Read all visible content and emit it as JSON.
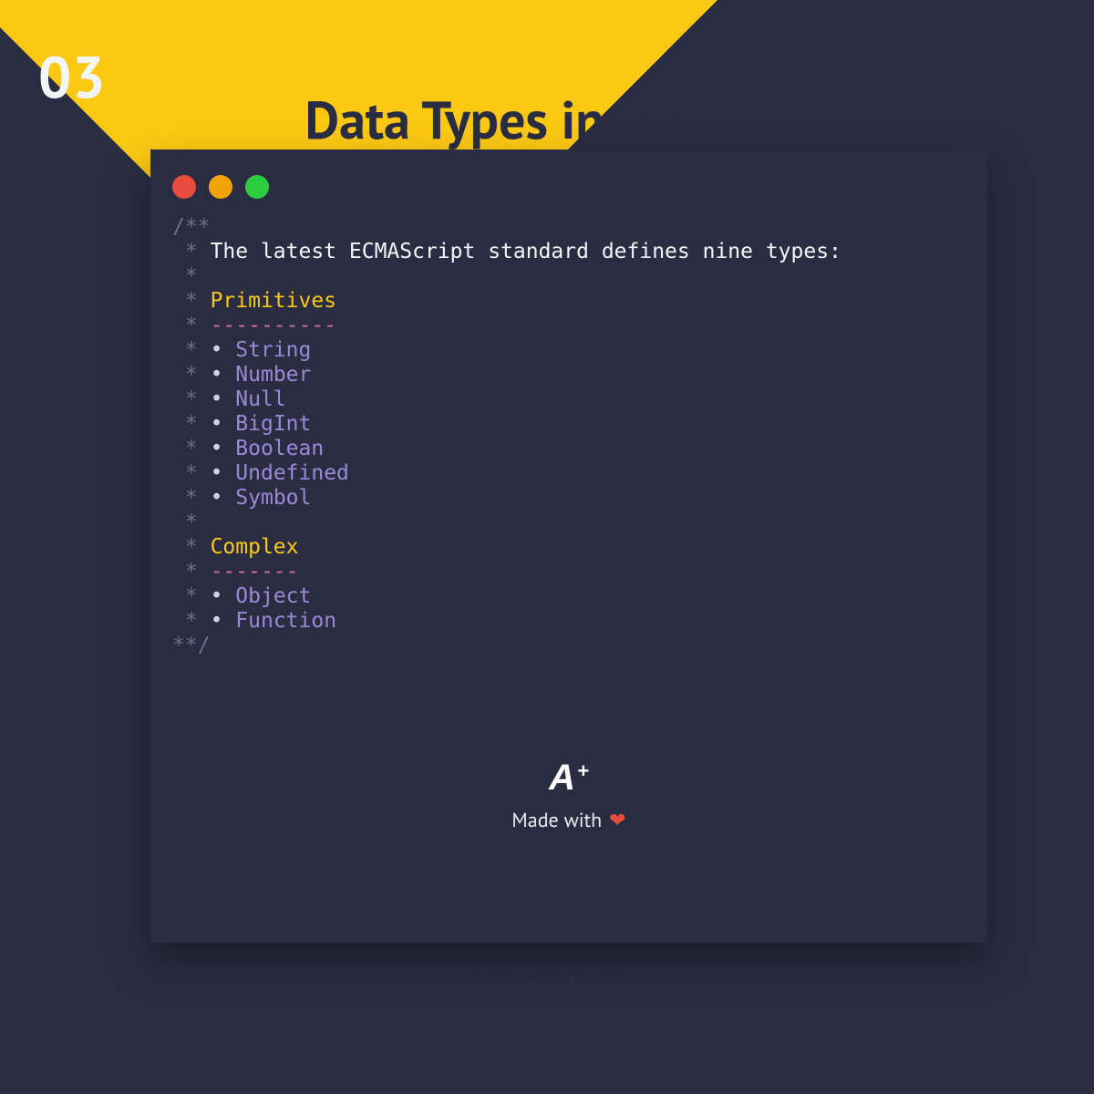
{
  "page_number": "03",
  "title": "Data Types in JavaScript",
  "code": {
    "open": "/**",
    "intro": "The latest ECMAScript standard defines nine types:",
    "section1": {
      "heading": "Primitives",
      "underline": "----------",
      "items": [
        "String",
        "Number",
        "Null",
        "BigInt",
        "Boolean",
        "Undefined",
        "Symbol"
      ]
    },
    "section2": {
      "heading": "Complex",
      "underline": "-------",
      "items": [
        "Object",
        "Function"
      ]
    },
    "close": "**/"
  },
  "footer": {
    "logo_text": "A",
    "logo_plus": "+",
    "made_with": "Made with",
    "heart": "❤"
  },
  "handle": "@flowforfrank"
}
